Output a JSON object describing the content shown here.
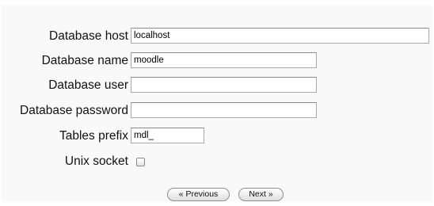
{
  "form": {
    "fields": [
      {
        "label": "Database host",
        "value": "localhost"
      },
      {
        "label": "Database name",
        "value": "moodle"
      },
      {
        "label": "Database user",
        "value": ""
      },
      {
        "label": "Database password",
        "value": ""
      },
      {
        "label": "Tables prefix",
        "value": "mdl_"
      }
    ],
    "unix_socket": {
      "label": "Unix socket",
      "checked": false
    }
  },
  "buttons": {
    "previous_label": "« Previous",
    "next_label": "Next »"
  }
}
